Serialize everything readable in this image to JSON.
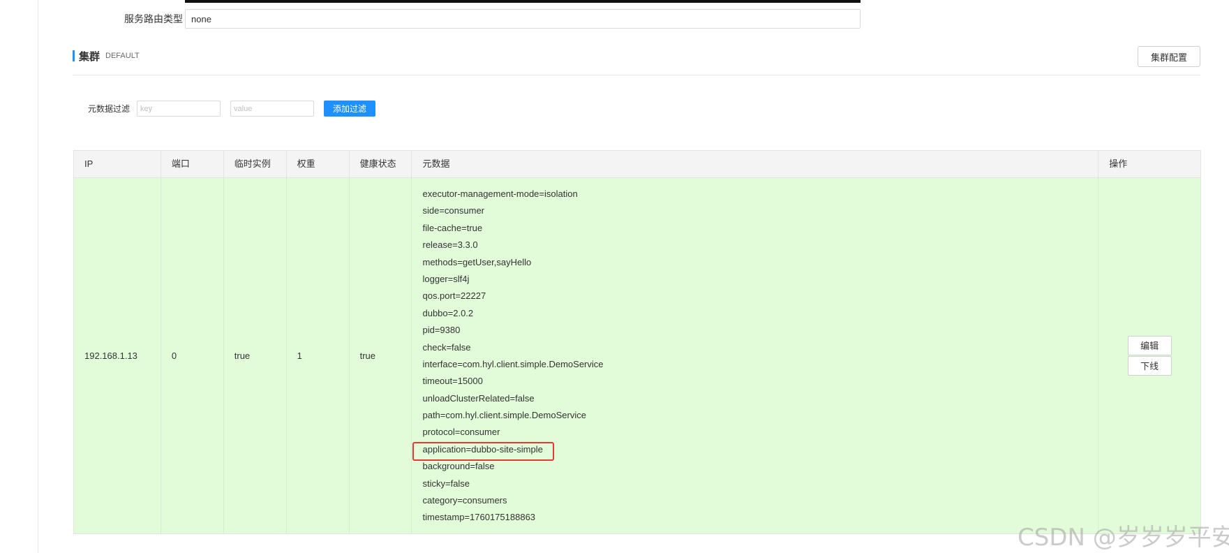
{
  "route": {
    "label": "服务路由类型",
    "value": "none"
  },
  "cluster": {
    "title": "集群",
    "name": "DEFAULT",
    "config_button": "集群配置"
  },
  "filter": {
    "label": "元数据过滤",
    "key_placeholder": "key",
    "value_placeholder": "value",
    "add_button": "添加过滤"
  },
  "table": {
    "headers": [
      "IP",
      "端口",
      "临时实例",
      "权重",
      "健康状态",
      "元数据",
      "操作"
    ],
    "rows": [
      {
        "ip": "192.168.1.13",
        "port": "0",
        "ephemeral": "true",
        "weight": "1",
        "healthy": "true",
        "metadata": [
          "executor-management-mode=isolation",
          "side=consumer",
          "file-cache=true",
          "release=3.3.0",
          "methods=getUser,sayHello",
          "logger=slf4j",
          "qos.port=22227",
          "dubbo=2.0.2",
          "pid=9380",
          "check=false",
          "interface=com.hyl.client.simple.DemoService",
          "timeout=15000",
          "unloadClusterRelated=false",
          "path=com.hyl.client.simple.DemoService",
          "protocol=consumer",
          "application=dubbo-site-simple",
          "background=false",
          "sticky=false",
          "category=consumers",
          "timestamp=1760175188863"
        ],
        "actions": {
          "edit": "编辑",
          "offline": "下线"
        }
      }
    ]
  },
  "watermark": "CSDN @岁岁岁平安",
  "colors": {
    "accent": "#1e90ff",
    "row_background": "#e2fbd9",
    "highlight_border": "#e53935"
  }
}
